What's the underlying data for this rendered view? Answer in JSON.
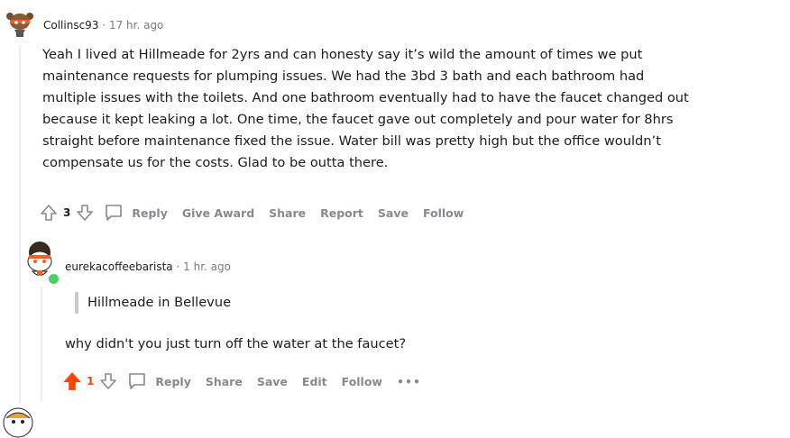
{
  "comment1": {
    "username": "Collinsc93",
    "separator": "·",
    "time": "17 hr. ago",
    "body": [
      "Yeah I lived at Hillmeade for 2yrs and can honesty say it’s wild the amount of times we put",
      "maintenance requests for plumping issues. We had the 3bd 3 bath and each bathroom had",
      "multiple issues with the toilets. And one bathroom eventually had to have the faucet changed out",
      "because it kept leaking a lot. One time, the faucet gave out completely and pour water for 8hrs",
      "straight before maintenance fixed the issue. Water bill was pretty high but the office wouldn’t",
      "compensate us for the costs. Glad to be outta there."
    ],
    "score": "3",
    "actions": {
      "reply": "Reply",
      "give_award": "Give Award",
      "share": "Share",
      "report": "Report",
      "save": "Save",
      "follow": "Follow"
    }
  },
  "comment2": {
    "username": "eurekacoffeebarista",
    "separator": "·",
    "time": "1 hr. ago",
    "quote": "Hillmeade in Bellevue",
    "body": "why didn't you just turn off the water at the faucet?",
    "score": "1",
    "actions": {
      "reply": "Reply",
      "share": "Share",
      "save": "Save",
      "edit": "Edit",
      "follow": "Follow",
      "more": "•••"
    }
  },
  "colors": {
    "upvote_active": "#ff4500",
    "action_gray": "#878a8c",
    "online": "#46d160",
    "thread_line": "#edeff1"
  }
}
